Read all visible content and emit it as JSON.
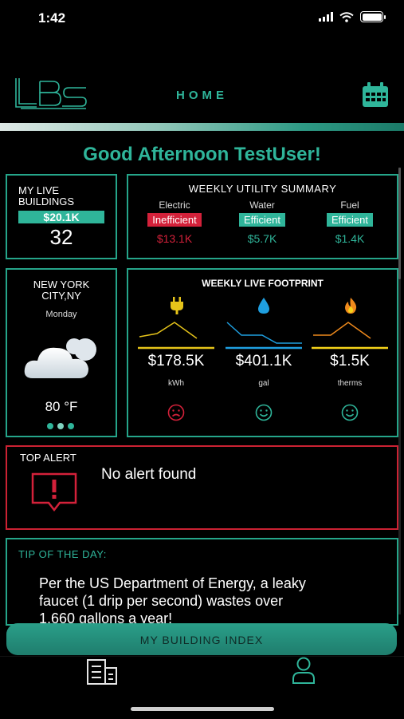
{
  "status": {
    "time": "1:42"
  },
  "header": {
    "logo": "LBS",
    "title": "HOME"
  },
  "greeting": "Good Afternoon TestUser!",
  "live_buildings": {
    "title": "MY LIVE BUILDINGS",
    "amount": "$20.1K",
    "count": "32"
  },
  "utility_summary": {
    "title": "WEEKLY UTILITY SUMMARY",
    "items": [
      {
        "label": "Electric",
        "status": "Inefficient",
        "value": "$13.1K"
      },
      {
        "label": "Water",
        "status": "Efficient",
        "value": "$5.7K"
      },
      {
        "label": "Fuel",
        "status": "Efficient",
        "value": "$1.4K"
      }
    ]
  },
  "weather": {
    "location": "NEW YORK CITY,NY",
    "day": "Monday",
    "temp": "80 °F"
  },
  "footprint": {
    "title": "WEEKLY LIVE FOOTPRINT",
    "items": [
      {
        "value": "$178.5K",
        "unit": "kWh",
        "icon": "plug-icon",
        "mood": "sad"
      },
      {
        "value": "$401.1K",
        "unit": "gal",
        "icon": "water-drop-icon",
        "mood": "happy"
      },
      {
        "value": "$1.5K",
        "unit": "therms",
        "icon": "flame-icon",
        "mood": "happy"
      }
    ]
  },
  "alert": {
    "title": "TOP ALERT",
    "message": "No alert found"
  },
  "tip": {
    "title": "TIP OF THE DAY:",
    "line1": "Per the US Department of Energy, a leaky",
    "line2": "faucet (1 drip per second) wastes over",
    "line3": "1,660 gallons a year!"
  },
  "bottom_button": "MY BUILDING INDEX",
  "colors": {
    "accent": "#2fb59a",
    "danger": "#d3213a",
    "border": "#25a58a"
  }
}
